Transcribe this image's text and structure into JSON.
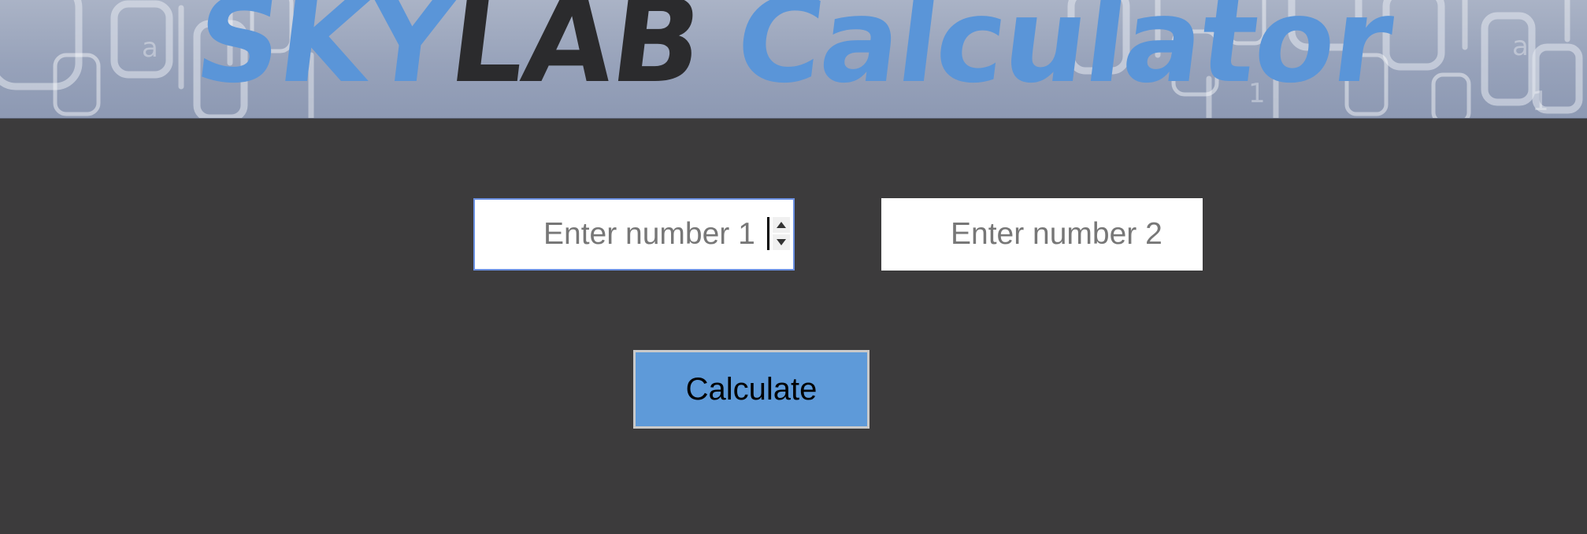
{
  "header": {
    "title_part1": "SKY",
    "title_part2": "LAB",
    "title_part3": "Calculator",
    "colors": {
      "accent": "#5a95d8",
      "dark": "#2b2b2d",
      "banner_bg": "#9aa5bc"
    }
  },
  "form": {
    "number1": {
      "placeholder": "Enter number 1",
      "value": ""
    },
    "number2": {
      "placeholder": "Enter number 2",
      "value": ""
    },
    "calculate_label": "Calculate"
  },
  "colors": {
    "page_background": "#3c3b3c",
    "button_background": "#5e9ad9",
    "focus_border": "#6a8fe0"
  }
}
